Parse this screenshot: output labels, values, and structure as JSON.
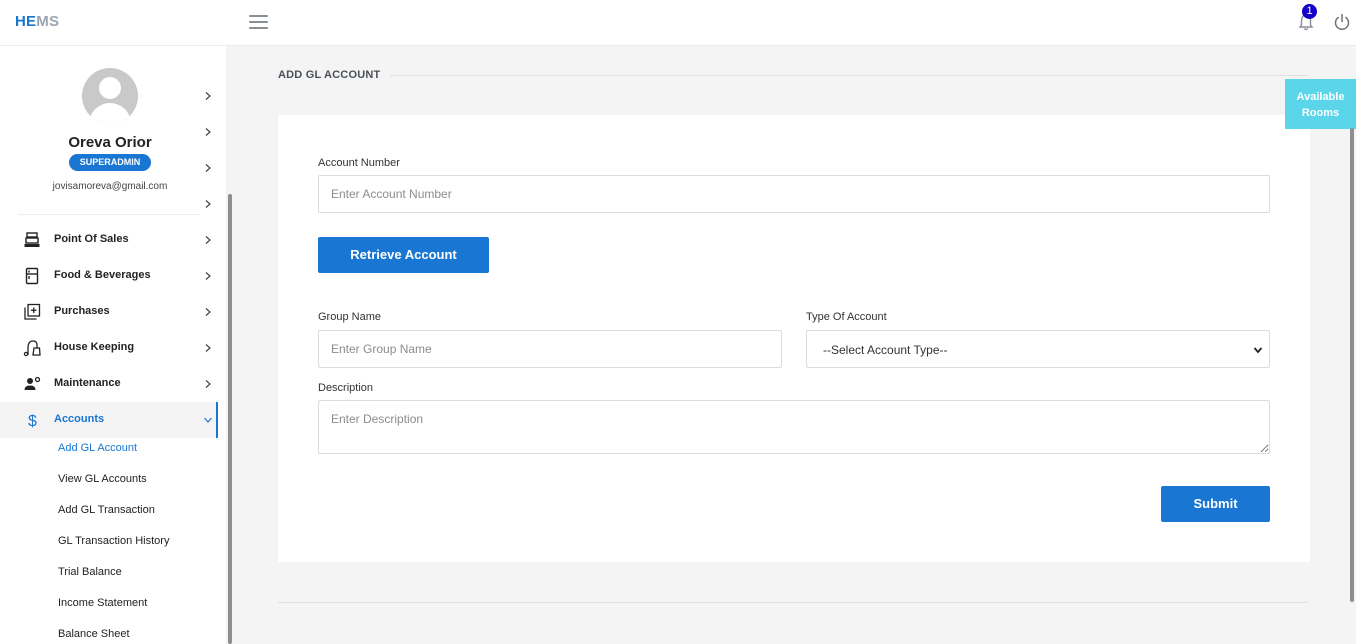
{
  "app": {
    "logo_he": "HE",
    "logo_ms": "MS",
    "notification_count": "1"
  },
  "profile": {
    "name": "Oreva Orior",
    "role": "SUPERADMIN",
    "email": "jovisamoreva@gmail.com"
  },
  "sidebar": {
    "items": [
      {
        "label": "Point Of Sales",
        "icon": "cash-register-icon"
      },
      {
        "label": "Food & Beverages",
        "icon": "fridge-icon"
      },
      {
        "label": "Purchases",
        "icon": "add-box-icon"
      },
      {
        "label": "House Keeping",
        "icon": "vacuum-icon"
      },
      {
        "label": "Maintenance",
        "icon": "worker-gear-icon"
      },
      {
        "label": "Accounts",
        "icon": "dollar-icon"
      }
    ],
    "subitems": [
      {
        "label": "Add GL Account"
      },
      {
        "label": "View GL Accounts"
      },
      {
        "label": "Add GL Transaction"
      },
      {
        "label": "GL Transaction History"
      },
      {
        "label": "Trial Balance"
      },
      {
        "label": "Income Statement"
      },
      {
        "label": "Balance Sheet"
      }
    ]
  },
  "page": {
    "title": "ADD GL ACCOUNT"
  },
  "form": {
    "account_number_label": "Account Number",
    "account_number_placeholder": "Enter Account Number",
    "account_number_value": "",
    "retrieve_label": "Retrieve Account",
    "group_name_label": "Group Name",
    "group_name_placeholder": "Enter Group Name",
    "group_name_value": "",
    "type_label": "Type Of Account",
    "type_selected": "--Select Account Type--",
    "description_label": "Description",
    "description_placeholder": "Enter Description",
    "description_value": "",
    "submit_label": "Submit"
  },
  "float_button": {
    "line1": "Available",
    "line2": "Rooms"
  },
  "colors": {
    "accent": "#1976d2",
    "available_rooms": "#5ad5ea",
    "badge": "#1400c8"
  }
}
